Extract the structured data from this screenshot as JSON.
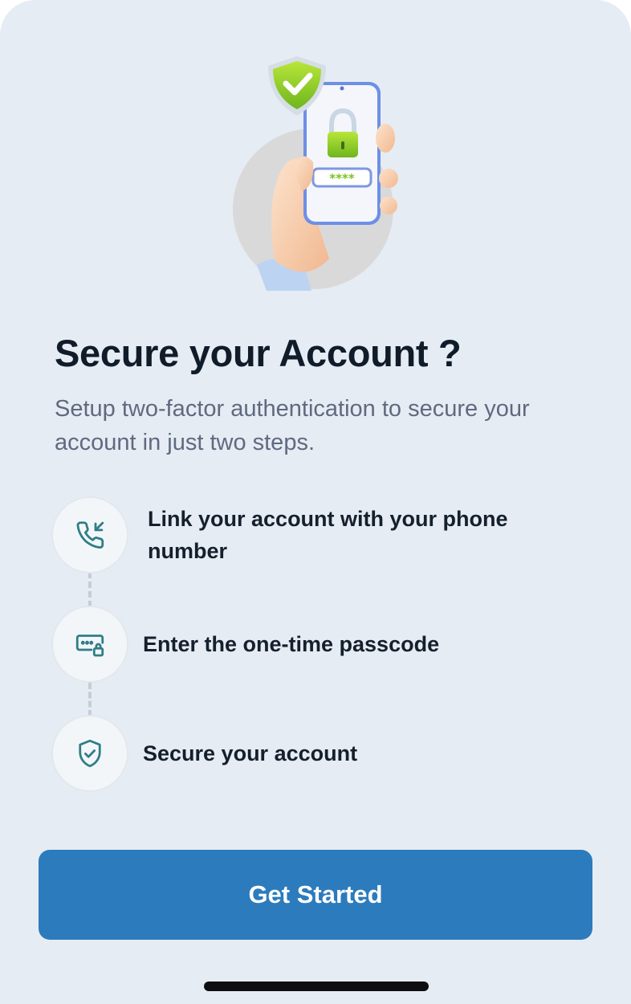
{
  "header": {
    "title": "Secure your Account ?",
    "subtitle": "Setup two-factor authentication to secure your account in just two steps."
  },
  "illustration": {
    "icon": "hand-holding-phone-with-lock-icon",
    "passcode_mask": "****"
  },
  "steps": [
    {
      "icon": "phone-incoming-icon",
      "label": "Link your account with your phone number"
    },
    {
      "icon": "passcode-lock-icon",
      "label": "Enter the one-time passcode"
    },
    {
      "icon": "shield-check-icon",
      "label": "Secure your account"
    }
  ],
  "actions": {
    "primary_label": "Get Started"
  },
  "colors": {
    "background": "#e6ecf3",
    "primary": "#2c7bbd",
    "icon_teal": "#2f7e86",
    "title": "#101c2a",
    "subtitle": "#5f6a80"
  }
}
